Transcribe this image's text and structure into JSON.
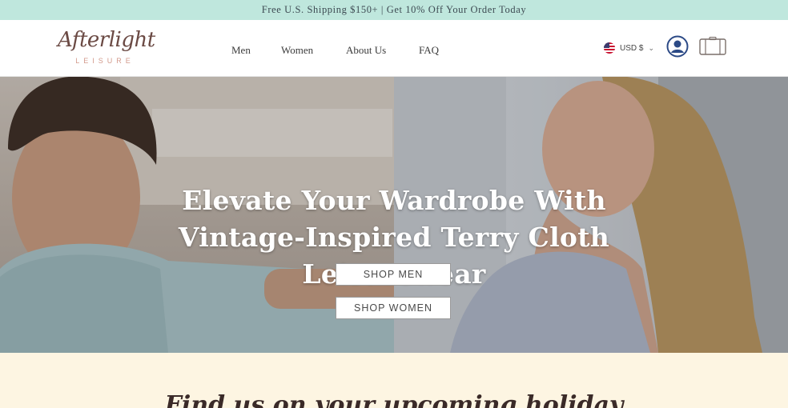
{
  "announcement": "Free U.S. Shipping $150+ | Get 10% Off Your Order Today",
  "logo": {
    "script": "Afterlight",
    "sub": "LEISURE"
  },
  "nav": {
    "men": "Men",
    "women": "Women",
    "about": "About Us",
    "faq": "FAQ"
  },
  "currency": {
    "label": "USD $",
    "chevron": "⌄"
  },
  "icons": {
    "user": "user-account-icon",
    "cart": "suitcase-cart-icon",
    "flag": "us-flag-icon"
  },
  "hero": {
    "title": "Elevate Your Wardrobe With Vintage-Inspired Terry Cloth Leisurewear",
    "shop_men": "SHOP MEN",
    "shop_women": "SHOP WOMEN"
  },
  "promo": {
    "heading": "Find us on your upcoming holiday"
  },
  "colors": {
    "announcement_bg": "#bfe7dd",
    "logo_script": "#6b4a44",
    "logo_sub": "#d39a8c",
    "promo_bg": "#fdf5e2"
  }
}
